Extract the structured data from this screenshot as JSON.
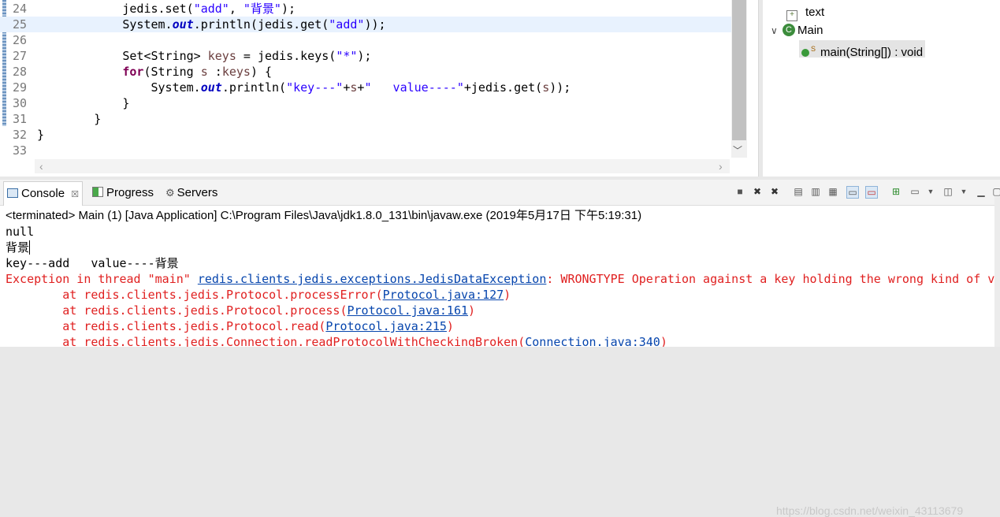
{
  "editor": {
    "lines": [
      {
        "n": "24",
        "segs": [
          {
            "t": "            jedis.set(",
            "c": ""
          },
          {
            "t": "\"add\"",
            "c": "str"
          },
          {
            "t": ", ",
            "c": ""
          },
          {
            "t": "\"背景\"",
            "c": "str"
          },
          {
            "t": ");",
            "c": ""
          }
        ]
      },
      {
        "n": "25",
        "hl": true,
        "segs": [
          {
            "t": "            System.",
            "c": ""
          },
          {
            "t": "out",
            "c": "fld"
          },
          {
            "t": ".println(jedis.get(",
            "c": ""
          },
          {
            "t": "\"add\"",
            "c": "str"
          },
          {
            "t": "));",
            "c": ""
          }
        ]
      },
      {
        "n": "26",
        "segs": []
      },
      {
        "n": "27",
        "segs": [
          {
            "t": "            Set<String> ",
            "c": ""
          },
          {
            "t": "keys",
            "c": "var"
          },
          {
            "t": " = jedis.keys(",
            "c": ""
          },
          {
            "t": "\"*\"",
            "c": "str"
          },
          {
            "t": ");",
            "c": ""
          }
        ]
      },
      {
        "n": "28",
        "segs": [
          {
            "t": "            ",
            "c": ""
          },
          {
            "t": "for",
            "c": "kw"
          },
          {
            "t": "(String ",
            "c": ""
          },
          {
            "t": "s",
            "c": "var"
          },
          {
            "t": " :",
            "c": ""
          },
          {
            "t": "keys",
            "c": "var"
          },
          {
            "t": ") {",
            "c": ""
          }
        ]
      },
      {
        "n": "29",
        "segs": [
          {
            "t": "                System.",
            "c": ""
          },
          {
            "t": "out",
            "c": "fld"
          },
          {
            "t": ".println(",
            "c": ""
          },
          {
            "t": "\"key---\"",
            "c": "str"
          },
          {
            "t": "+",
            "c": ""
          },
          {
            "t": "s",
            "c": "var"
          },
          {
            "t": "+",
            "c": ""
          },
          {
            "t": "\"   value----\"",
            "c": "str"
          },
          {
            "t": "+jedis.get(",
            "c": ""
          },
          {
            "t": "s",
            "c": "var"
          },
          {
            "t": "));",
            "c": ""
          }
        ]
      },
      {
        "n": "30",
        "segs": [
          {
            "t": "            }",
            "c": ""
          }
        ]
      },
      {
        "n": "31",
        "segs": [
          {
            "t": "        }",
            "c": ""
          }
        ]
      },
      {
        "n": "32",
        "segs": [
          {
            "t": "}",
            "c": ""
          }
        ]
      },
      {
        "n": "33",
        "segs": []
      }
    ]
  },
  "outline": {
    "field": "text",
    "class": "Main",
    "method": "main(String[]) : void",
    "method_modifier": "S"
  },
  "console": {
    "tabs": {
      "console": "Console",
      "progress": "Progress",
      "servers": "Servers"
    },
    "close_glyph": "☒",
    "description": "<terminated> Main (1) [Java Application] C:\\Program Files\\Java\\jdk1.8.0_131\\bin\\javaw.exe (2019年5月17日 下午5:19:31)",
    "out": {
      "l1": "null",
      "l2": "背景",
      "l3": "key---add   value----背景"
    },
    "exception": {
      "prefix": "Exception in thread \"main\" ",
      "class_link": "redis.clients.jedis.exceptions.JedisDataException",
      "message": ": WRONGTYPE Operation against a key holding the wrong kind of va"
    },
    "stack": [
      {
        "at": "        at redis.clients.jedis.Protocol.processError(",
        "link": "Protocol.java:127",
        "end": ")"
      },
      {
        "at": "        at redis.clients.jedis.Protocol.process(",
        "link": "Protocol.java:161",
        "end": ")"
      },
      {
        "at": "        at redis.clients.jedis.Protocol.read(",
        "link": "Protocol.java:215",
        "end": ")"
      },
      {
        "at": "        at redis.clients.jedis.Connection.readProtocolWithCheckingBroken(",
        "link": "Connection.java:340",
        "end": ")"
      }
    ]
  },
  "watermark": "https://blog.csdn.net/weixin_43113679"
}
